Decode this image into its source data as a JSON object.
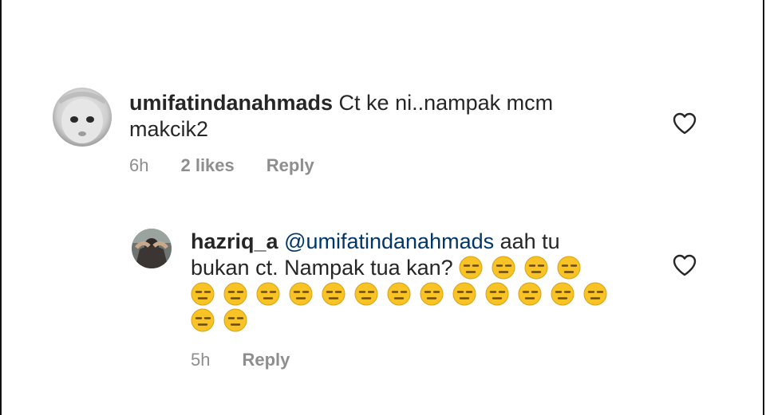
{
  "comments": [
    {
      "username": "umifatindanahmads",
      "text_line1": " Ct ke ni..nampak mcm",
      "text_line2": "makcik2",
      "time": "6h",
      "likes": "2 likes",
      "reply_label": "Reply",
      "like_icon": "heart-outline-icon"
    },
    {
      "username": "hazriq_a",
      "mention": "@umifatindanahmads",
      "text_line1_rest": " aah tu",
      "text_line2": "bukan ct. Nampak tua kan? ",
      "emoji_name": "expressionless-face-emoji",
      "emoji_counts": [
        4,
        13,
        2
      ],
      "time": "5h",
      "reply_label": "Reply",
      "like_icon": "heart-outline-icon"
    }
  ],
  "colors": {
    "text": "#262626",
    "muted": "#8e8e8e",
    "mention": "#00376b",
    "emoji": "#f7c325"
  }
}
